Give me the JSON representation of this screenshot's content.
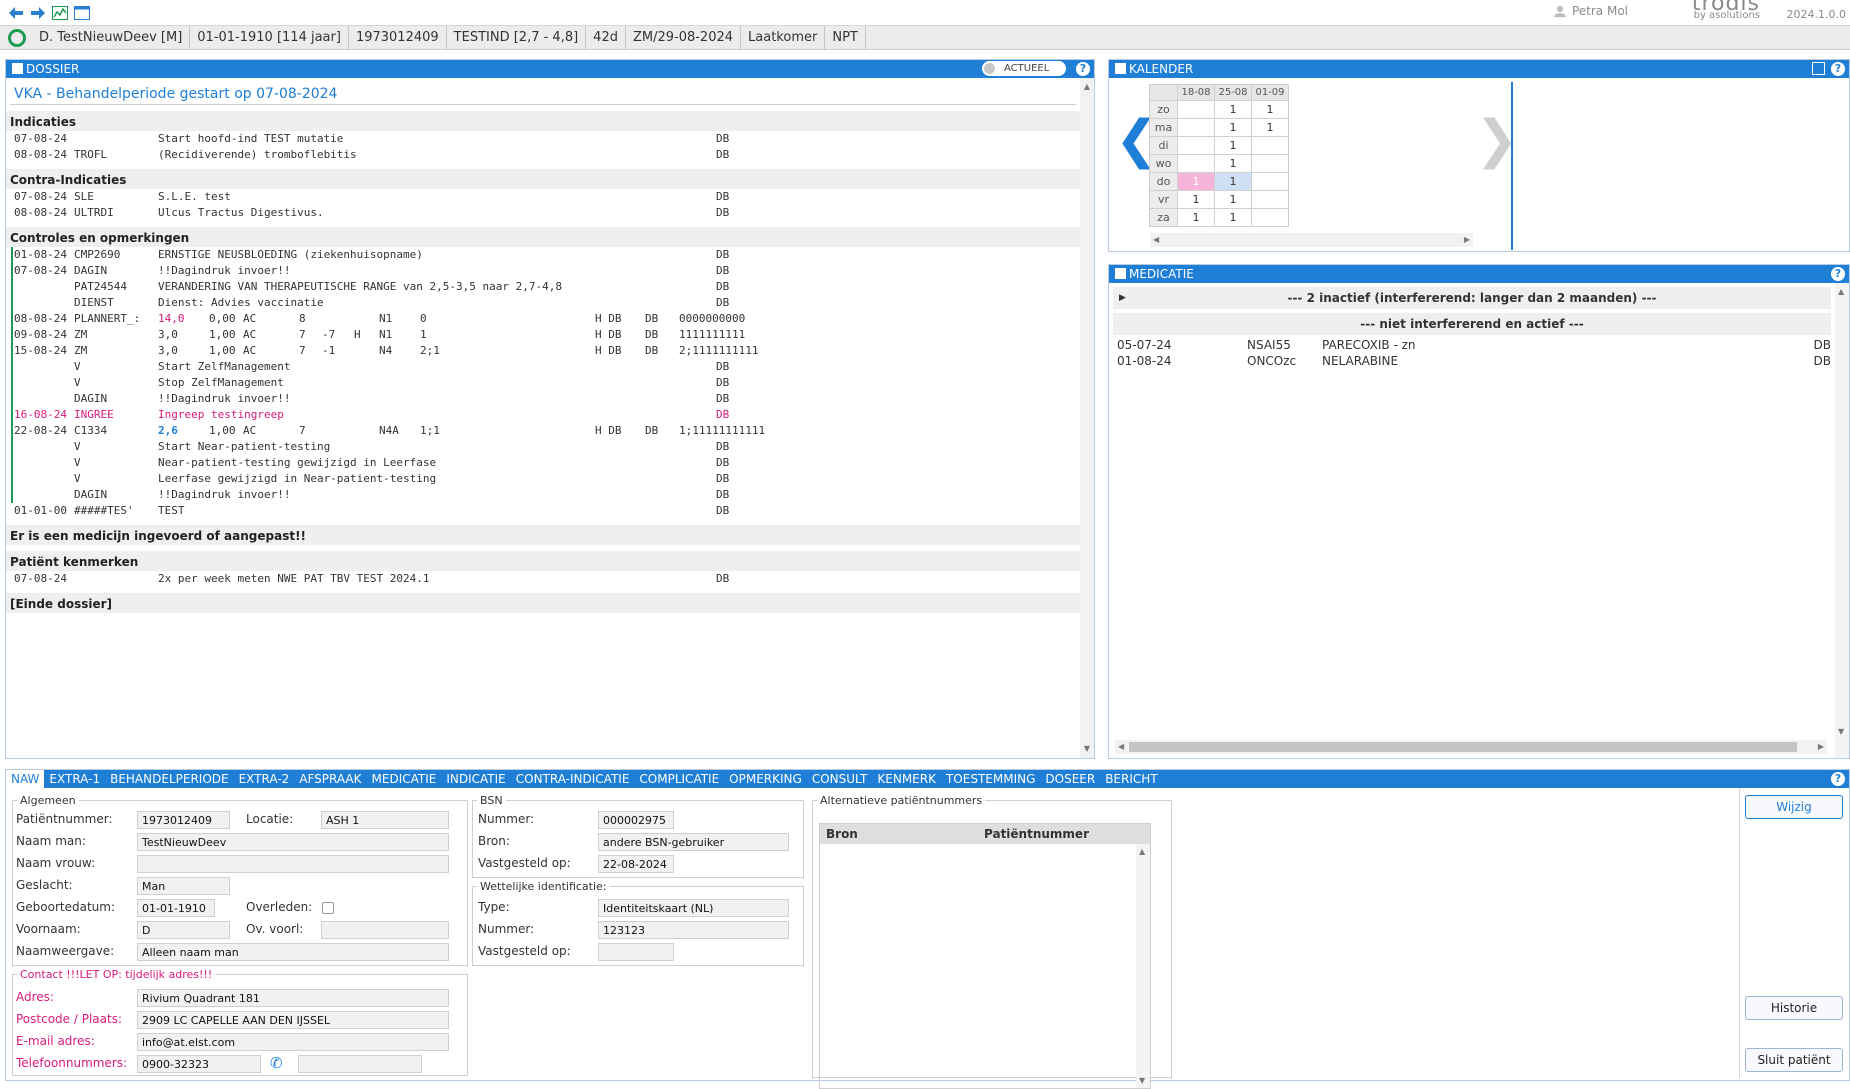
{
  "app": {
    "user": "Petra Mol",
    "brand_logo_text": "trodis",
    "brand_sub": "by asolutions",
    "version": "2024.1.0.0"
  },
  "patient_bar": [
    "D. TestNieuwDeev [M]",
    "01-01-1910 [114 jaar]",
    "1973012409",
    "TESTIND [2,7 - 4,8]",
    "42d",
    "ZM/29-08-2024",
    "Laatkomer",
    "NPT"
  ],
  "dossier": {
    "header": "DOSSIER",
    "toggle_label": "ACTUEEL",
    "title": "VKA - Behandelperiode gestart op 07-08-2024",
    "sections": {
      "indicaties": "Indicaties",
      "contra": "Contra-Indicaties",
      "controles": "Controles en opmerkingen",
      "medicijn": "Er is een medicijn ingevoerd of aangepast!!",
      "kenmerken": "Patiënt kenmerken",
      "einde": "[Einde dossier]"
    },
    "indicaties": [
      {
        "d": "07-08-24",
        "c": "",
        "t": "Start hoofd-ind TEST mutatie",
        "db": "DB"
      },
      {
        "d": "08-08-24",
        "c": "TROFL",
        "t": "(Recidiverende) tromboflebitis",
        "db": "DB"
      }
    ],
    "contra": [
      {
        "d": "07-08-24",
        "c": "SLE",
        "t": "S.L.E. test",
        "db": "DB"
      },
      {
        "d": "08-08-24",
        "c": "ULTRDI",
        "t": "Ulcus Tractus Digestivus.",
        "db": "DB"
      }
    ],
    "controles": [
      {
        "d": "01-08-24",
        "c": "CMP2690",
        "t": "ERNSTIGE NEUSBLOEDING (ziekenhuisopname)",
        "db": "DB"
      },
      {
        "d": "07-08-24",
        "c": "DAGIN",
        "t": "!!Dagindruk invoer!!",
        "db": "DB"
      },
      {
        "d": "",
        "c": "PAT24544",
        "t": "VERANDERING VAN THERAPEUTISCHE RANGE van 2,5-3,5 naar 2,7-4,8",
        "db": "DB"
      },
      {
        "d": "",
        "c": "DIENST",
        "t": "Dienst: Advies vaccinatie",
        "db": "DB"
      },
      {
        "d": "08-08-24",
        "c": "PLANNERT_:",
        "inr": "14,0",
        "inr_style": "pink",
        "dose": "0,00",
        "ac": "AC",
        "n1": "8",
        "n2": "",
        "h": "",
        "nr": "N1",
        "code": "0",
        "hdb": "H DB",
        "db": "DB",
        "sched": "0000000000"
      },
      {
        "d": "09-08-24",
        "c": "ZM",
        "inr": "3,0",
        "inr_style": "",
        "dose": "1,00",
        "ac": "AC",
        "n1": "7",
        "n2": "-7",
        "h": "H",
        "nr": "N1",
        "code": "1",
        "hdb": "H DB",
        "db": "DB",
        "sched": "1111111111"
      },
      {
        "d": "15-08-24",
        "c": "ZM",
        "inr": "3,0",
        "inr_style": "",
        "dose": "1,00",
        "ac": "AC",
        "n1": "7",
        "n2": "-1",
        "h": "",
        "nr": "N4",
        "code": "2;1",
        "hdb": "H DB",
        "db": "DB",
        "sched": "2;1111111111"
      },
      {
        "d": "",
        "c": "V",
        "t": "Start ZelfManagement",
        "db": "DB"
      },
      {
        "d": "",
        "c": "V",
        "t": "Stop ZelfManagement",
        "db": "DB"
      },
      {
        "d": "",
        "c": "DAGIN",
        "t": "!!Dagindruk invoer!!",
        "db": "DB"
      },
      {
        "d": "16-08-24",
        "c": "INGREE",
        "t": "Ingreep testingreep",
        "db": "DB",
        "pink": true
      },
      {
        "d": "22-08-24",
        "c": "C1334",
        "inr": "2,6",
        "inr_style": "blue",
        "dose": "1,00",
        "ac": "AC",
        "n1": "7",
        "n2": "",
        "h": "",
        "nr": "N4A",
        "code": "1;1",
        "hdb": "H DB",
        "db": "DB",
        "sched": "1;11111111111"
      },
      {
        "d": "",
        "c": "V",
        "t": "Start Near-patient-testing",
        "db": "DB"
      },
      {
        "d": "",
        "c": "V",
        "t": "Near-patient-testing gewijzigd in Leerfase",
        "db": "DB"
      },
      {
        "d": "",
        "c": "V",
        "t": "Leerfase gewijzigd in Near-patient-testing",
        "db": "DB"
      },
      {
        "d": "",
        "c": "DAGIN",
        "t": "!!Dagindruk invoer!!",
        "db": "DB"
      },
      {
        "d": "01-01-00",
        "c": "#####TES'",
        "t": "TEST",
        "db": "DB",
        "nobar": true
      }
    ],
    "kenmerken": [
      {
        "d": "07-08-24",
        "c": "",
        "t": "2x per week meten NWE PAT TBV TEST 2024.1",
        "db": "DB"
      }
    ]
  },
  "kalender": {
    "header": "KALENDER",
    "weeks": [
      "18-08",
      "25-08",
      "01-09"
    ],
    "days": [
      {
        "day": "zo",
        "v": [
          "",
          "1",
          "1"
        ]
      },
      {
        "day": "ma",
        "v": [
          "",
          "1",
          "1"
        ]
      },
      {
        "day": "di",
        "v": [
          "",
          "1",
          ""
        ]
      },
      {
        "day": "wo",
        "v": [
          "",
          "1",
          ""
        ]
      },
      {
        "day": "do",
        "v": [
          "1",
          "1",
          ""
        ],
        "hl": [
          "pk",
          "bl",
          ""
        ]
      },
      {
        "day": "vr",
        "v": [
          "1",
          "1",
          ""
        ]
      },
      {
        "day": "za",
        "v": [
          "1",
          "1",
          ""
        ]
      }
    ]
  },
  "medicatie": {
    "header": "MEDICATIE",
    "inactive_label": "--- 2 inactief (interfererend: langer dan 2 maanden) ---",
    "active_label": "--- niet interfererend en actief ---",
    "items": [
      {
        "date": "05-07-24",
        "code": "NSAI55",
        "name": "PARECOXIB - zn",
        "db": "DB"
      },
      {
        "date": "01-08-24",
        "code": "ONCOzc",
        "name": "NELARABINE",
        "db": "DB"
      }
    ]
  },
  "tabs": [
    "NAW",
    "EXTRA-1",
    "BEHANDELPERIODE",
    "EXTRA-2",
    "AFSPRAAK",
    "MEDICATIE",
    "INDICATIE",
    "CONTRA-INDICATIE",
    "COMPLICATIE",
    "OPMERKING",
    "CONSULT",
    "KENMERK",
    "TOESTEMMING",
    "DOSEER",
    "BERICHT"
  ],
  "naw": {
    "algemeen": {
      "legend": "Algemeen",
      "patientnummer_label": "Patiëntnummer:",
      "patientnummer": "1973012409",
      "locatie_label": "Locatie:",
      "locatie": "ASH 1",
      "naam_man_label": "Naam man:",
      "naam_man": "TestNieuwDeev",
      "naam_vrouw_label": "Naam vrouw:",
      "naam_vrouw": "",
      "geslacht_label": "Geslacht:",
      "geslacht": "Man",
      "geboortedatum_label": "Geboortedatum:",
      "geboortedatum": "01-01-1910",
      "overleden_label": "Overleden:",
      "voornaam_label": "Voornaam:",
      "voornaam": "D",
      "ov_voorl_label": "Ov. voorl:",
      "ov_voorl": "",
      "naamweergave_label": "Naamweergave:",
      "naamweergave": "Alleen naam man"
    },
    "contact": {
      "legend": "Contact !!!LET OP: tijdelijk adres!!!",
      "adres_label": "Adres:",
      "adres": "Rivium Quadrant 181",
      "postcode_label": "Postcode / Plaats:",
      "postcode": "2909 LC CAPELLE AAN DEN IJSSEL",
      "email_label": "E-mail adres:",
      "email": "info@at.elst.com",
      "telefoon_label": "Telefoonnummers:",
      "telefoon": "0900-32323",
      "telefoon2": ""
    },
    "bsn": {
      "legend": "BSN",
      "nummer_label": "Nummer:",
      "nummer": "000002975",
      "bron_label": "Bron:",
      "bron": "andere BSN-gebruiker",
      "vastgesteld_label": "Vastgesteld op:",
      "vastgesteld": "22-08-2024"
    },
    "wettelijk": {
      "legend": "Wettelijke identificatie:",
      "type_label": "Type:",
      "type": "Identiteitskaart (NL)",
      "nummer_label": "Nummer:",
      "nummer": "123123",
      "vastgesteld_label": "Vastgesteld op:",
      "vastgesteld": ""
    },
    "alternatief": {
      "legend": "Alternatieve patiëntnummers",
      "col_bron": "Bron",
      "col_nummer": "Patiëntnummer"
    },
    "buttons": {
      "wijzig": "Wijzig",
      "historie": "Historie",
      "sluit": "Sluit patiënt"
    }
  }
}
